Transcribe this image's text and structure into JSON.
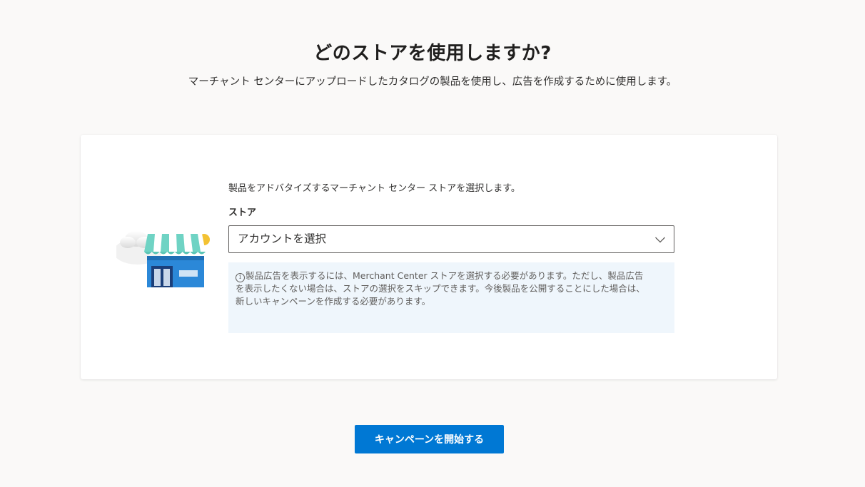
{
  "header": {
    "title": "どのストアを使用しますか?",
    "subtitle": "マーチャント センターにアップロードしたカタログの製品を使用し、広告を作成するために使用します。"
  },
  "card": {
    "illustration_icon": "storefront-icon",
    "instruction": "製品をアドバタイズするマーチャント センター ストアを選択します。",
    "store_field": {
      "label": "ストア",
      "selected_value": "アカウントを選択",
      "chevron_icon": "chevron-down-icon"
    },
    "info_message": {
      "icon": "info-icon",
      "text": "製品広告を表示するには、Merchant Center ストアを選択する必要があります。ただし、製品広告を表示したくない場合は、ストアの選択をスキップできます。今後製品を公開することにした場合は、新しいキャンペーンを作成する必要があります。"
    }
  },
  "footer": {
    "start_campaign_label": "キャンペーンを開始する"
  },
  "colors": {
    "primary": "#0078d4",
    "info_background": "#eff6fc",
    "page_background": "#faf9f8"
  }
}
